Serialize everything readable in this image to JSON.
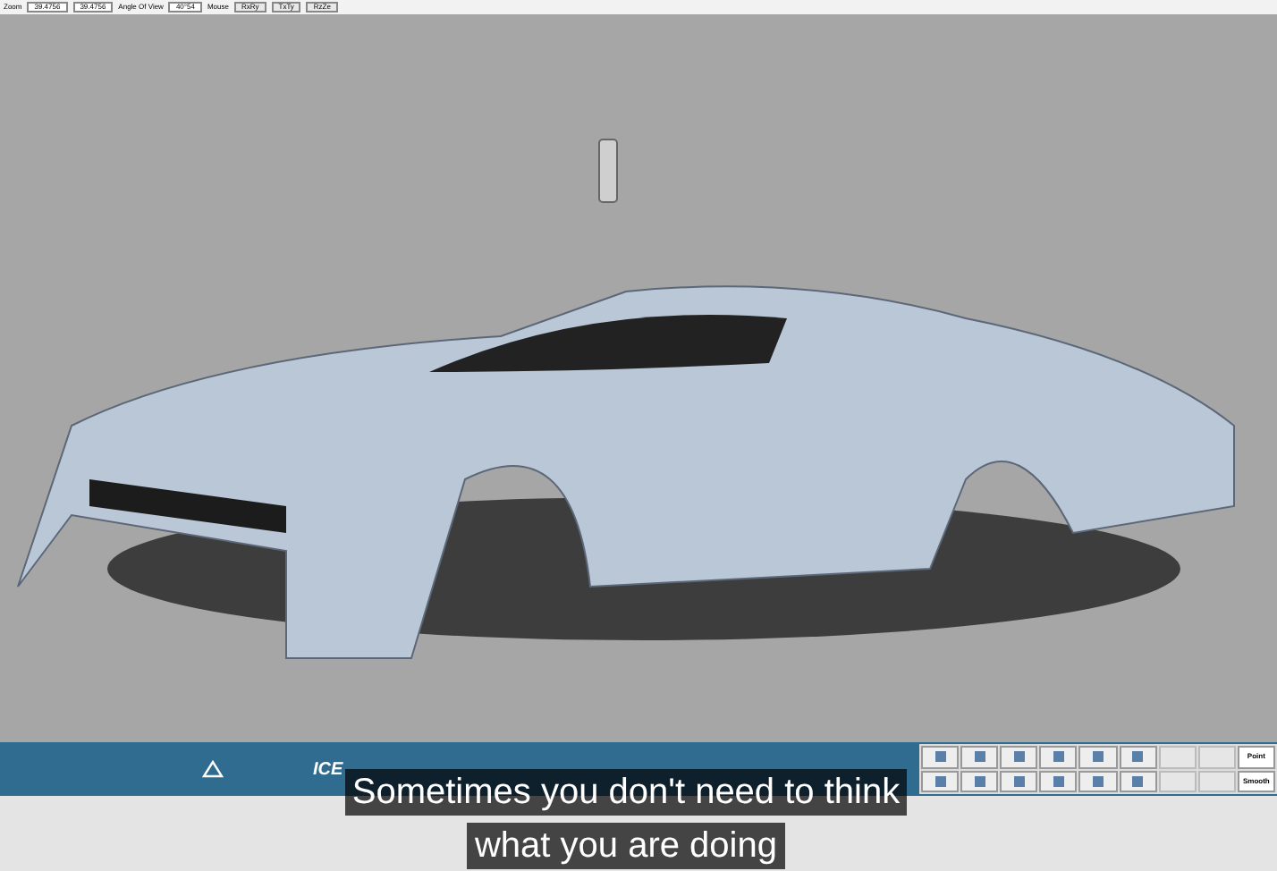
{
  "toolbar": {
    "zoom_label": "Zoom",
    "zoom_fields": [
      "39.4756",
      "39.4756"
    ],
    "angle_label": "Angle Of View",
    "angle_value": "40°54",
    "mouse_label": "Mouse",
    "mouse_buttons": [
      "RxRy",
      "TxTy",
      "RzZe"
    ]
  },
  "bottom_bar": {
    "product_logo": "ICE"
  },
  "tool_panel": {
    "buttons": [
      {
        "kind": "icon"
      },
      {
        "kind": "icon"
      },
      {
        "kind": "icon"
      },
      {
        "kind": "icon"
      },
      {
        "kind": "icon"
      },
      {
        "kind": "icon"
      },
      {
        "kind": "blank"
      },
      {
        "kind": "blank"
      },
      {
        "kind": "text",
        "label": "Point"
      },
      {
        "kind": "icon"
      },
      {
        "kind": "icon"
      },
      {
        "kind": "icon"
      },
      {
        "kind": "icon"
      },
      {
        "kind": "icon"
      },
      {
        "kind": "icon"
      },
      {
        "kind": "blank"
      },
      {
        "kind": "blank"
      },
      {
        "kind": "text",
        "label": "Smooth"
      }
    ]
  },
  "subtitles": [
    "Sometimes you don't need to think",
    "what you are doing"
  ]
}
